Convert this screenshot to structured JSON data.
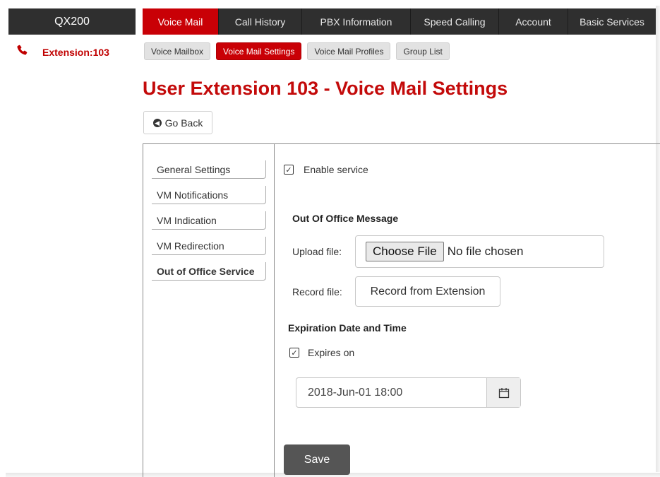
{
  "app": {
    "brand": "QX200"
  },
  "topnav": {
    "tabs": [
      {
        "label": "Voice Mail",
        "active": true
      },
      {
        "label": "Call History",
        "active": false
      },
      {
        "label": "PBX Information",
        "active": false
      },
      {
        "label": "Speed Calling",
        "active": false
      },
      {
        "label": "Account",
        "active": false
      },
      {
        "label": "Basic Services",
        "active": false
      }
    ]
  },
  "extension": {
    "label": "Extension:103",
    "icon": "phone-icon"
  },
  "subnav": {
    "tabs": [
      {
        "label": "Voice Mailbox",
        "active": false
      },
      {
        "label": "Voice Mail Settings",
        "active": true
      },
      {
        "label": "Voice Mail Profiles",
        "active": false
      },
      {
        "label": "Group List",
        "active": false
      }
    ]
  },
  "page": {
    "title": "User Extension 103 - Voice Mail Settings",
    "go_back": "Go Back"
  },
  "sidemenu": {
    "items": [
      {
        "label": "General Settings",
        "active": false
      },
      {
        "label": "VM Notifications",
        "active": false
      },
      {
        "label": "VM Indication",
        "active": false
      },
      {
        "label": "VM Redirection",
        "active": false
      },
      {
        "label": "Out of Office Service",
        "active": true
      }
    ]
  },
  "form": {
    "enable_service": {
      "label": "Enable service",
      "checked": true
    },
    "out_of_office_heading": "Out Of Office Message",
    "upload": {
      "label": "Upload file:",
      "button": "Choose File",
      "status": "No file chosen"
    },
    "record": {
      "label": "Record file:",
      "button": "Record from Extension"
    },
    "expiration_heading": "Expiration Date and Time",
    "expires_on": {
      "label": "Expires on",
      "checked": true
    },
    "expiration_value": "2018-Jun-01 18:00",
    "save": "Save"
  },
  "colors": {
    "accent": "#c90006",
    "nav_bg": "#2f2f2f",
    "title_red": "#c30a0a"
  }
}
